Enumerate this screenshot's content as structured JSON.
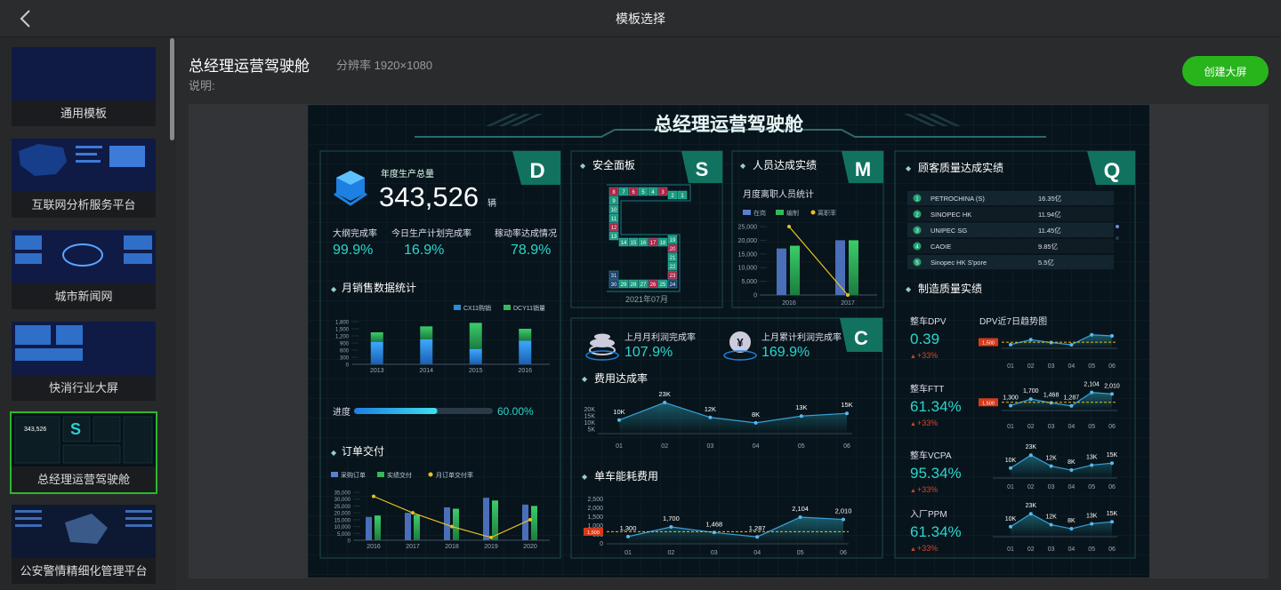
{
  "topbar": {
    "title": "模板选择"
  },
  "sidebar": {
    "templates": [
      {
        "label": "通用模板"
      },
      {
        "label": "互联网分析服务平台"
      },
      {
        "label": "城市新闻网"
      },
      {
        "label": "快消行业大屏"
      },
      {
        "label": "总经理运营驾驶舱",
        "selected": true
      },
      {
        "label": "公安警情精细化管理平台"
      }
    ]
  },
  "main": {
    "title": "总经理运营驾驶舱",
    "resolution": "分辨率 1920×1080",
    "description_label": "说明:",
    "create_button": "创建大屏"
  },
  "dashboard": {
    "title": "总经理运营驾驶舱",
    "d": {
      "letter": "D",
      "annual_label": "年度生产总量",
      "annual_value": "343,526",
      "annual_unit": "辆",
      "kpis": [
        {
          "label": "大纲完成率",
          "value": "99.9%"
        },
        {
          "label": "今日生产计划完成率",
          "value": "16.9%"
        },
        {
          "label": "稼动率达成情况",
          "value": "78.9%"
        }
      ],
      "monthly_title": "月销售数据统计",
      "progress_label": "进度",
      "progress_value": "60.00%",
      "progress": 0.6,
      "order_title": "订单交付"
    },
    "s": {
      "title": "安全面板",
      "letter": "S",
      "caption": "2021年07月"
    },
    "m": {
      "title": "人员达成实绩",
      "letter": "M",
      "subtitle": "月度离职人员统计"
    },
    "c": {
      "letter": "C",
      "profit_month_label": "上月月利润完成率",
      "profit_month_value": "107.9%",
      "profit_cum_label": "上月累计利润完成率",
      "profit_cum_value": "169.9%",
      "cost_title": "费用达成率",
      "energy_title": "单车能耗费用"
    },
    "q": {
      "title": "顾客质量达成实绩",
      "letter": "Q",
      "rank": [
        {
          "name": "PETROCHINA (S)",
          "value": "16.35亿"
        },
        {
          "name": "SINOPEC HK",
          "value": "11.94亿"
        },
        {
          "name": "UNIPEC SG",
          "value": "11.45亿"
        },
        {
          "name": "CAOIE",
          "value": "9.85亿"
        },
        {
          "name": "Sinopec HK S'pore",
          "value": "5.5亿"
        }
      ],
      "mfg_title": "制造质量实绩",
      "trend_title": "DPV近7日趋势图",
      "metrics": [
        {
          "label": "整车DPV",
          "value": "0.39",
          "delta": "+33%"
        },
        {
          "label": "整车FTT",
          "value": "61.34%",
          "delta": "+33%"
        },
        {
          "label": "整车VCPA",
          "value": "95.34%",
          "delta": "+33%"
        },
        {
          "label": "入厂PPM",
          "value": "61.34%",
          "delta": "+33%"
        }
      ]
    }
  },
  "chart_data": [
    {
      "type": "bar",
      "title": "月销售数据统计",
      "categories": [
        "2013",
        "2014",
        "2015",
        "2016"
      ],
      "series": [
        {
          "name": "CX11购销",
          "values": [
            950,
            1050,
            650,
            1000
          ]
        },
        {
          "name": "DCY11销量",
          "values": [
            400,
            550,
            1100,
            500
          ]
        }
      ],
      "ylim": [
        0,
        1800
      ],
      "yticks": [
        "1,800",
        "1,500",
        "1,200",
        "900",
        "600",
        "300",
        "0"
      ],
      "legend": "top-right"
    },
    {
      "type": "bar",
      "title": "订单交付",
      "categories": [
        "2016",
        "2017",
        "2018",
        "2019",
        "2020"
      ],
      "series": [
        {
          "name": "采购订单",
          "values": [
            17000,
            20000,
            24000,
            31000,
            26000
          ]
        },
        {
          "name": "实绩交付",
          "values": [
            18000,
            18500,
            23000,
            29000,
            25000
          ]
        },
        {
          "name": "月订单交付率",
          "type": "line",
          "values": [
            32000,
            20000,
            10000,
            2000,
            15000
          ]
        }
      ],
      "ylim": [
        0,
        35000
      ],
      "yticks": [
        "35,000",
        "30,000",
        "25,000",
        "20,000",
        "15,000",
        "10,000",
        "5,000",
        "0"
      ],
      "legend": "top-left"
    },
    {
      "type": "bar",
      "title": "月度离职人员统计",
      "categories": [
        "2016",
        "2017"
      ],
      "series": [
        {
          "name": "在岗",
          "values": [
            17000,
            20000
          ]
        },
        {
          "name": "编制",
          "values": [
            18000,
            20000
          ]
        },
        {
          "name": "离职率",
          "type": "line",
          "values": [
            25000,
            0
          ]
        }
      ],
      "ylim": [
        0,
        25000
      ],
      "yticks": [
        "25,000",
        "20,000",
        "15,000",
        "10,000",
        "5,000",
        "0"
      ],
      "legend": "top-left"
    },
    {
      "type": "area",
      "title": "费用达成率",
      "categories": [
        "01",
        "02",
        "03",
        "04",
        "05",
        "06"
      ],
      "values": [
        10,
        23,
        12,
        8,
        13,
        15
      ],
      "labels": [
        "10K",
        "23K",
        "12K",
        "8K",
        "13K",
        "15K"
      ],
      "yticks": [
        "20K",
        "15K",
        "10K",
        "5K"
      ],
      "ylim": [
        0,
        25
      ]
    },
    {
      "type": "area",
      "title": "单车能耗费用",
      "categories": [
        "01",
        "02",
        "03",
        "04",
        "05",
        "06"
      ],
      "values": [
        1300,
        1700,
        1468,
        1287,
        2104,
        2010
      ],
      "labels": [
        "1,300",
        "1,700",
        "1,468",
        "1,287",
        "2,104",
        "2,010"
      ],
      "yticks": [
        "2,500",
        "2,000",
        "1,500",
        "1,000",
        "500",
        "0"
      ],
      "ylim": [
        0,
        2500
      ],
      "reference": 1500,
      "reference_label": "1,500"
    },
    {
      "type": "line",
      "title": "DPV近7日趋势图",
      "categories": [
        "01",
        "02",
        "03",
        "04",
        "05",
        "06"
      ],
      "values": [
        1300,
        1700,
        1468,
        1287,
        2104,
        2010
      ],
      "reference_label": "1,500"
    },
    {
      "type": "line",
      "title": "整车FTT",
      "categories": [
        "01",
        "02",
        "03",
        "04",
        "05",
        "06"
      ],
      "values": [
        1300,
        1700,
        1468,
        1287,
        2104,
        2010
      ],
      "labels": [
        "1,300",
        "1,700",
        "1,468",
        "1,287",
        "2,104",
        "2,010"
      ],
      "reference_label": "1,500"
    },
    {
      "type": "area",
      "title": "整车VCPA",
      "categories": [
        "01",
        "02",
        "03",
        "04",
        "05",
        "06"
      ],
      "values": [
        10,
        23,
        12,
        8,
        13,
        15
      ],
      "labels": [
        "10K",
        "23K",
        "12K",
        "8K",
        "13K",
        "15K"
      ]
    },
    {
      "type": "area",
      "title": "入厂PPM",
      "categories": [
        "01",
        "02",
        "03",
        "04",
        "05",
        "06"
      ],
      "values": [
        10,
        23,
        12,
        8,
        13,
        15
      ],
      "labels": [
        "10K",
        "23K",
        "12K",
        "8K",
        "13K",
        "15K"
      ]
    }
  ]
}
